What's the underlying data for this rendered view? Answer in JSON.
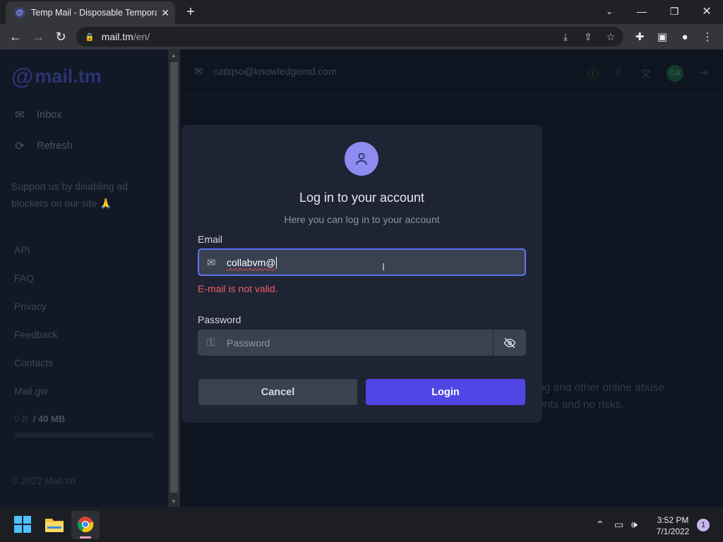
{
  "browser": {
    "tab_title": "Temp Mail - Disposable Tempora",
    "tab_favicon": "@",
    "url_domain": "mail.tm",
    "url_path": "/en/"
  },
  "sidebar": {
    "logo_at": "@",
    "logo_mail": "mail",
    "logo_tm": ".tm",
    "items": [
      {
        "label": "Inbox",
        "icon": "inbox-icon"
      },
      {
        "label": "Refresh",
        "icon": "refresh-icon"
      }
    ],
    "support_text": "Support us by disabling ad blockers on our site 🙏",
    "links": [
      "API",
      "FAQ",
      "Privacy",
      "Feedback",
      "Contacts",
      "Mail.gw"
    ],
    "storage_used": "0 B",
    "storage_total": "/ 40 MB",
    "storage_fraction": 0,
    "copyright": "© 2022 Mail.tm"
  },
  "topbar": {
    "address": "catlqso@knowledgemd.com",
    "avatar_initials": "CA"
  },
  "background_text": {
    "line1": "ng and other online abuse.",
    "line2": "ents and no risks."
  },
  "modal": {
    "title": "Log in to your account",
    "subtitle": "Here you can log in to your account",
    "email_label": "Email",
    "email_value": "collabvm@",
    "email_error": "E-mail is not valid.",
    "password_label": "Password",
    "password_placeholder": "Password",
    "cancel_label": "Cancel",
    "login_label": "Login"
  },
  "taskbar": {
    "time": "3:52 PM",
    "date": "7/1/2022",
    "notification_count": "1"
  },
  "colors": {
    "accent": "#5046e5",
    "focus_border": "#5e73f4",
    "error": "#ee5d6c",
    "avatar_bg": "#8e8cf0"
  }
}
